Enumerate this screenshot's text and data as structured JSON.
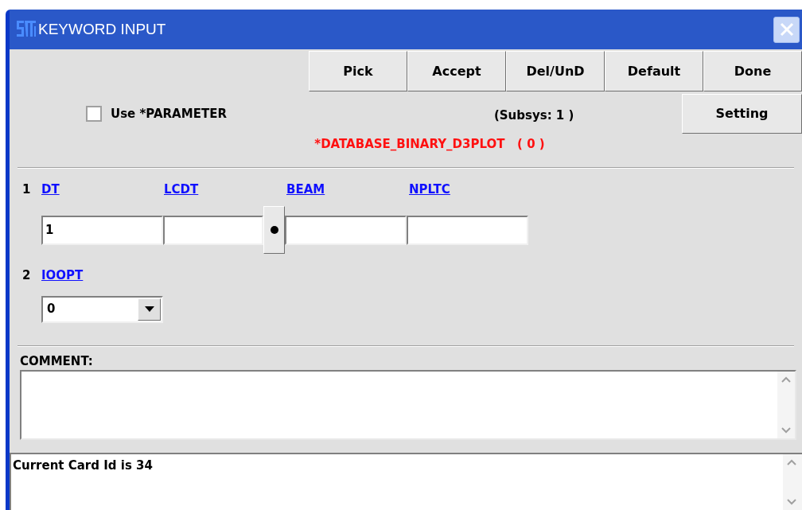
{
  "window": {
    "title": "KEYWORD INPUT"
  },
  "buttons": [
    "Pick",
    "Accept",
    "Del/UnD",
    "Default",
    "Done"
  ],
  "use_parameter": {
    "label": "Use *PARAMETER",
    "checked": false
  },
  "subsys": "(Subsys: 1 )",
  "setting_button": "Setting",
  "keyword": "*DATABASE_BINARY_D3PLOT   ( 0 )",
  "cards": [
    {
      "number": "1",
      "fields": [
        {
          "kind": "text",
          "label": "DT",
          "value": "1"
        },
        {
          "kind": "text",
          "label": "LCDT"
        },
        {
          "kind": "text",
          "label": "BEAM"
        },
        {
          "kind": "text",
          "label": "NPLTC"
        }
      ]
    },
    {
      "number": "2",
      "fields": [
        {
          "kind": "dropdown",
          "label": "IOOPT",
          "value": "0"
        }
      ]
    }
  ],
  "comment": {
    "label": "COMMENT:"
  },
  "status": "Current Card Id is 34"
}
